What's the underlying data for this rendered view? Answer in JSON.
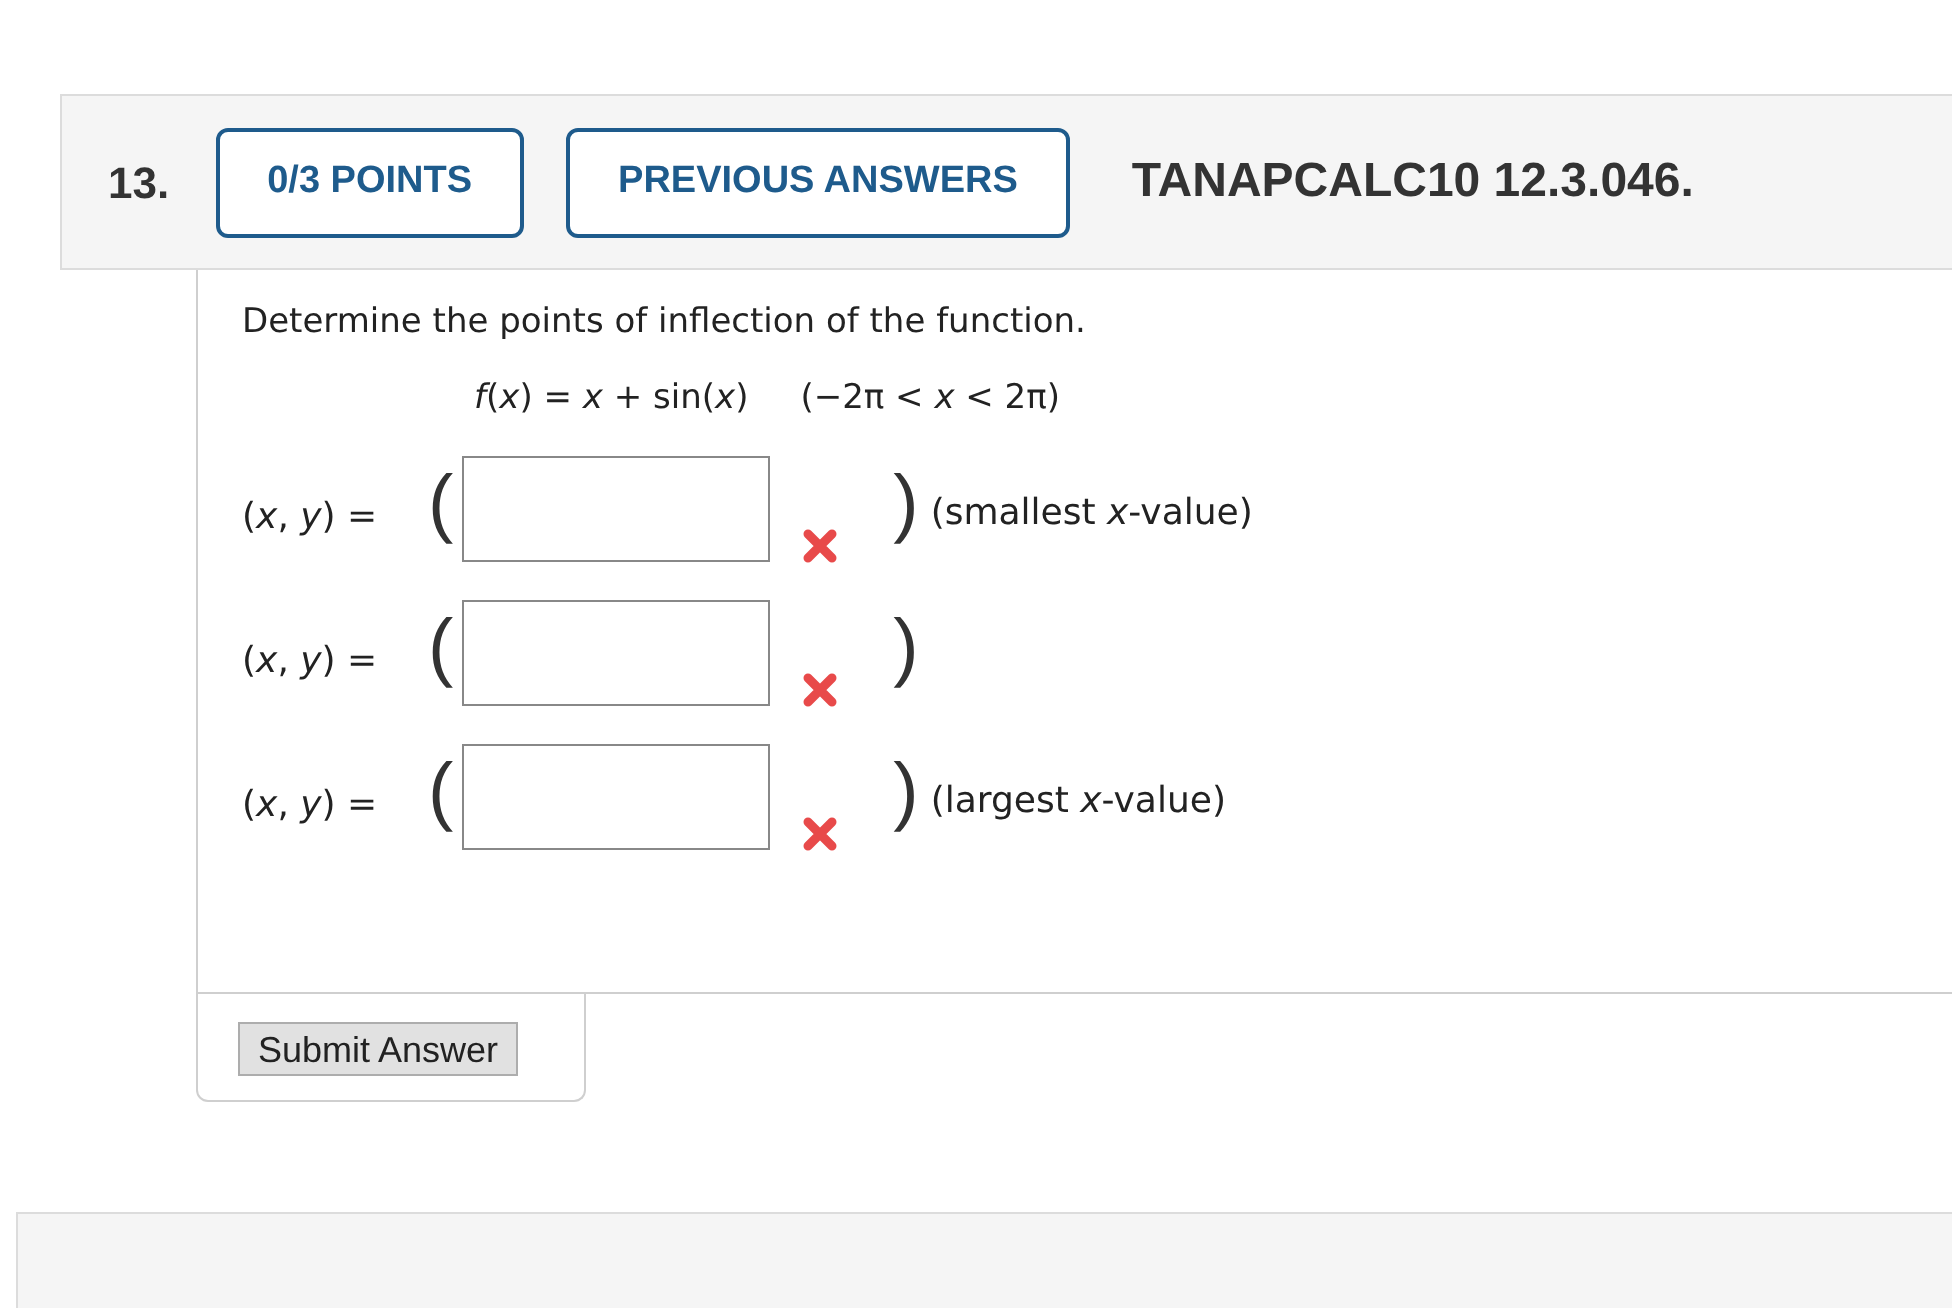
{
  "question": {
    "number": "13.",
    "points_button": "0/3 POINTS",
    "previous_answers_button": "PREVIOUS ANSWERS",
    "code": "TANAPCALC10 12.3.046."
  },
  "prompt": "Determine the points of inflection of the function.",
  "formula": "*f*(*x*) = *x* + sin(*x*)",
  "domain": "(−2π < *x* < 2π)",
  "answers": [
    {
      "label": "(*x*, *y*) =",
      "open_paren": "(",
      "close_paren": ")",
      "incorrect": true,
      "note": "(smallest *x*-value)"
    },
    {
      "label": "(*x*, *y*) =",
      "open_paren": "(",
      "close_paren": ")",
      "incorrect": true
    },
    {
      "label": "(*x*, *y*) =",
      "open_paren": "(",
      "close_paren": ")",
      "incorrect": true,
      "note": "(largest *x*-value)"
    }
  ],
  "submit_button": "Submit Answer"
}
